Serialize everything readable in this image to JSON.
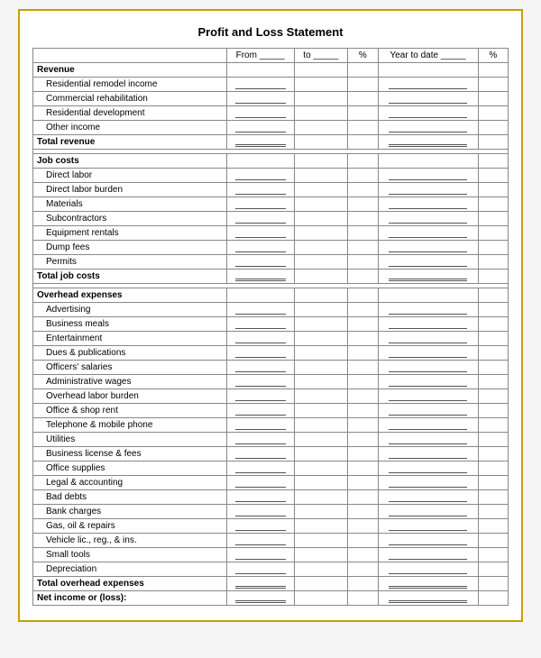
{
  "title": "Profit and Loss Statement",
  "header": {
    "col1": "",
    "col_from": "From _____",
    "col_to": "to _____",
    "col_pct1": "%",
    "col_ytd": "Year to date _____",
    "col_pct2": "%"
  },
  "sections": [
    {
      "type": "section-header",
      "label": "Revenue"
    },
    {
      "type": "item",
      "label": "Residential remodel income",
      "indent": true
    },
    {
      "type": "item",
      "label": "Commercial rehabilitation",
      "indent": true
    },
    {
      "type": "item",
      "label": "Residential development",
      "indent": true
    },
    {
      "type": "item",
      "label": "Other income",
      "indent": true
    },
    {
      "type": "total",
      "label": "Total revenue"
    },
    {
      "type": "spacer"
    },
    {
      "type": "section-header",
      "label": "Job costs"
    },
    {
      "type": "item",
      "label": "Direct labor",
      "indent": true
    },
    {
      "type": "item",
      "label": "Direct labor burden",
      "indent": true
    },
    {
      "type": "item",
      "label": "Materials",
      "indent": true
    },
    {
      "type": "item",
      "label": "Subcontractors",
      "indent": true
    },
    {
      "type": "item",
      "label": "Equipment rentals",
      "indent": true
    },
    {
      "type": "item",
      "label": "Dump fees",
      "indent": true
    },
    {
      "type": "item",
      "label": "Permits",
      "indent": true
    },
    {
      "type": "total",
      "label": "Total job costs"
    },
    {
      "type": "spacer"
    },
    {
      "type": "section-header",
      "label": "Overhead expenses"
    },
    {
      "type": "item",
      "label": "Advertising",
      "indent": true
    },
    {
      "type": "item",
      "label": "Business meals",
      "indent": true
    },
    {
      "type": "item",
      "label": "Entertainment",
      "indent": true
    },
    {
      "type": "item",
      "label": "Dues & publications",
      "indent": true
    },
    {
      "type": "item",
      "label": "Officers' salaries",
      "indent": true
    },
    {
      "type": "item",
      "label": "Administrative wages",
      "indent": true
    },
    {
      "type": "item",
      "label": "Overhead labor burden",
      "indent": true
    },
    {
      "type": "item",
      "label": "Office & shop rent",
      "indent": true
    },
    {
      "type": "item",
      "label": "Telephone & mobile phone",
      "indent": true
    },
    {
      "type": "item",
      "label": "Utilities",
      "indent": true
    },
    {
      "type": "item",
      "label": "Business license & fees",
      "indent": true
    },
    {
      "type": "item",
      "label": "Office supplies",
      "indent": true
    },
    {
      "type": "item",
      "label": "Legal & accounting",
      "indent": true
    },
    {
      "type": "item",
      "label": "Bad debts",
      "indent": true
    },
    {
      "type": "item",
      "label": "Bank charges",
      "indent": true
    },
    {
      "type": "item",
      "label": "Gas, oil & repairs",
      "indent": true
    },
    {
      "type": "item",
      "label": "Vehicle lic., reg., & ins.",
      "indent": true
    },
    {
      "type": "item",
      "label": "Small tools",
      "indent": true
    },
    {
      "type": "item",
      "label": "Depreciation",
      "indent": true
    },
    {
      "type": "total",
      "label": "Total overhead expenses"
    },
    {
      "type": "total",
      "label": "Net income or (loss):"
    }
  ]
}
